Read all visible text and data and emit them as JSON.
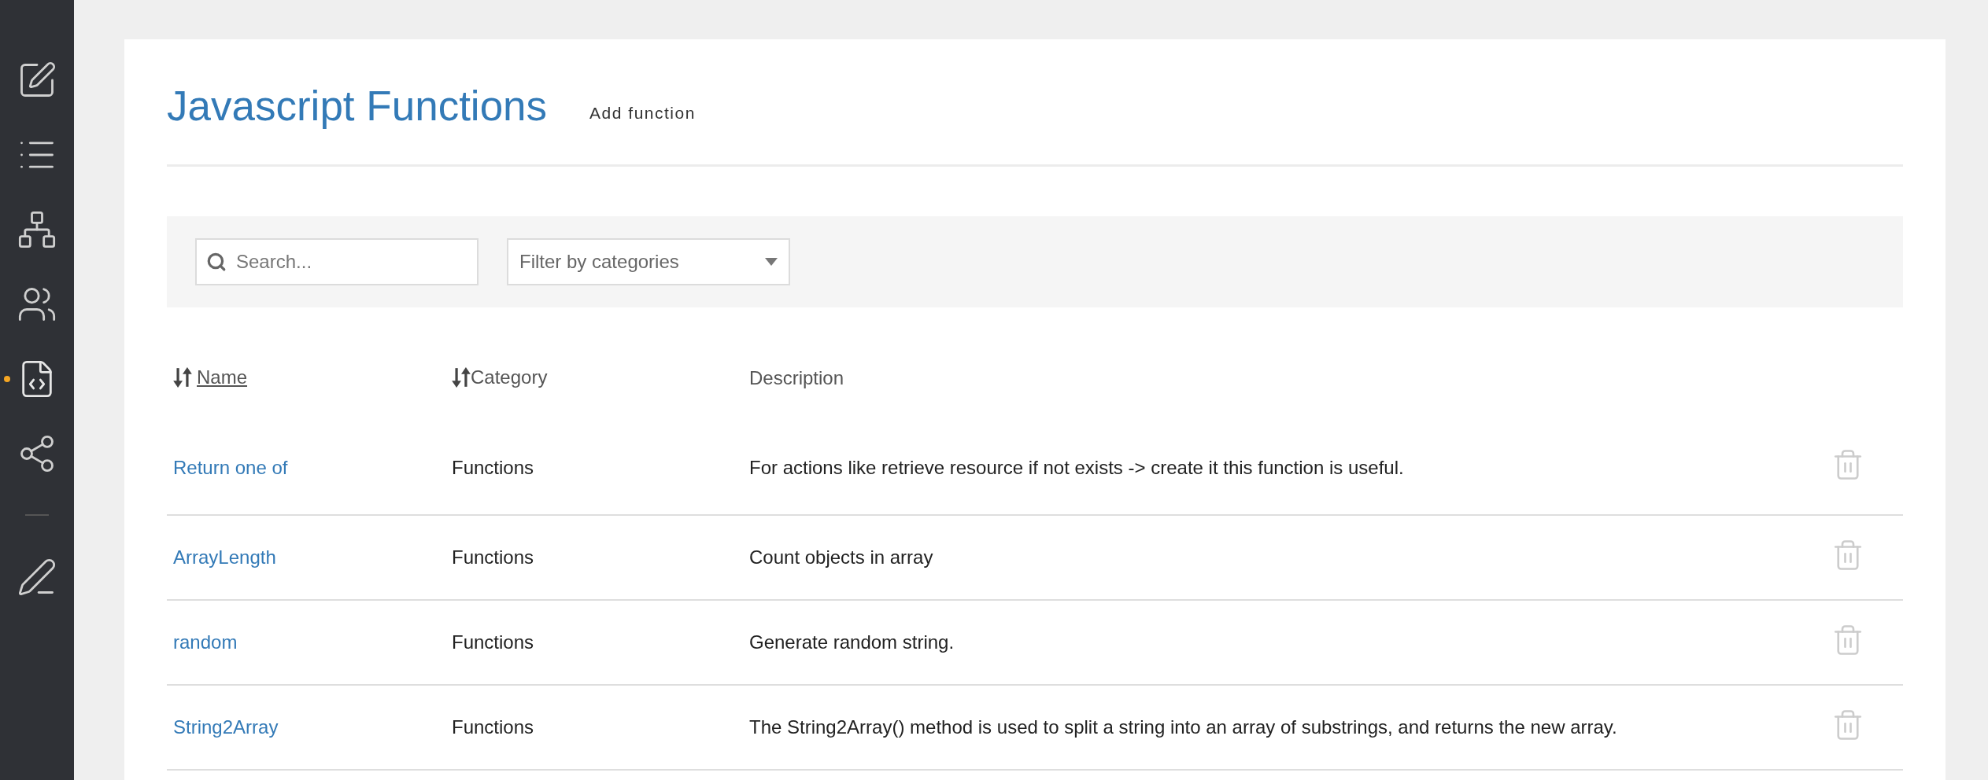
{
  "sidebar": {
    "groups": [
      [
        {
          "selected": false
        },
        {
          "selected": false
        },
        {
          "selected": false
        },
        {
          "selected": false
        },
        {
          "selected": true
        },
        {
          "selected": false
        }
      ],
      [
        {
          "selected": false
        }
      ]
    ]
  },
  "header": {
    "title": "Javascript Functions",
    "action": "Add function"
  },
  "filters": {
    "search": {
      "placeholder": "Search..."
    },
    "category": {
      "value": "Filter by categories"
    }
  },
  "table": {
    "columns": [
      {
        "label": "Name",
        "sortable": true,
        "active": true
      },
      {
        "label": "Category",
        "sortable": true,
        "active": false
      },
      {
        "label": "Description",
        "sortable": false,
        "active": false
      }
    ],
    "rows": [
      {
        "name": "Return one of",
        "category": "Functions",
        "description": "For actions like retrieve resource if not exists -> create it this function is useful."
      },
      {
        "name": "ArrayLength",
        "category": "Functions",
        "description": "Count objects in array"
      },
      {
        "name": "random",
        "category": "Functions",
        "description": "Generate random string."
      },
      {
        "name": "String2Array",
        "category": "Functions",
        "description": "The String2Array() method is used to split a string into an array of substrings, and returns the new array."
      }
    ]
  }
}
